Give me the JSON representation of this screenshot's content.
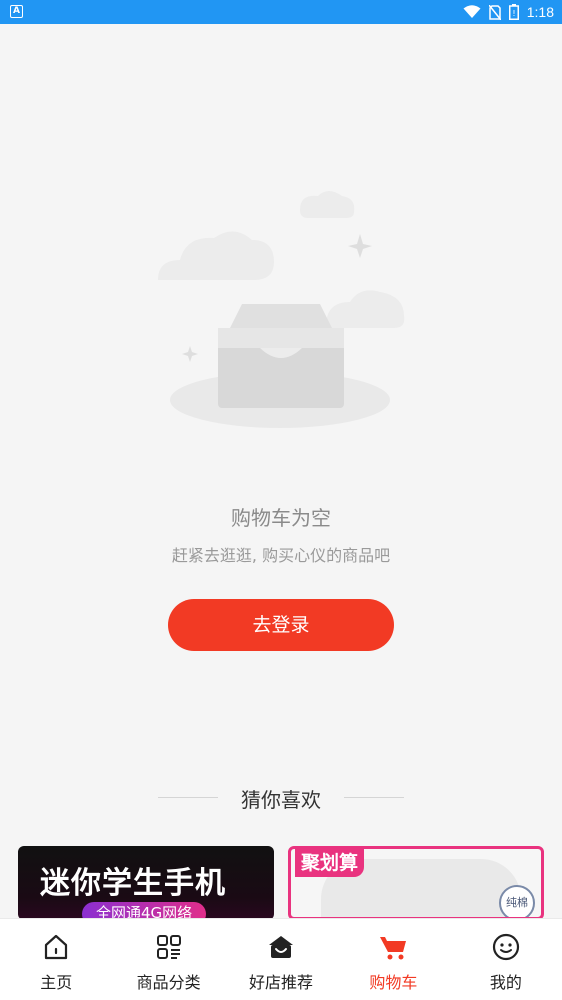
{
  "status_bar": {
    "left_icon": "A",
    "time": "1:18",
    "icons": [
      "wifi-icon",
      "no-sim-icon",
      "battery-icon"
    ]
  },
  "empty_state": {
    "title": "购物车为空",
    "subtitle": "赶紧去逛逛, 购买心仪的商品吧",
    "button_label": "去登录"
  },
  "recommend": {
    "title": "猜你喜欢",
    "products": [
      {
        "title": "迷你学生手机",
        "badge": "全网通4G网络"
      },
      {
        "tag": "聚划算",
        "badge": "纯棉"
      }
    ]
  },
  "tabs": [
    {
      "label": "主页",
      "icon": "home-icon",
      "active": false
    },
    {
      "label": "商品分类",
      "icon": "category-icon",
      "active": false
    },
    {
      "label": "好店推荐",
      "icon": "shop-icon",
      "active": false
    },
    {
      "label": "购物车",
      "icon": "cart-icon",
      "active": true
    },
    {
      "label": "我的",
      "icon": "profile-icon",
      "active": false
    }
  ],
  "colors": {
    "accent": "#f23a24",
    "status_bar": "#2196f3",
    "background": "#f5f5f5"
  }
}
